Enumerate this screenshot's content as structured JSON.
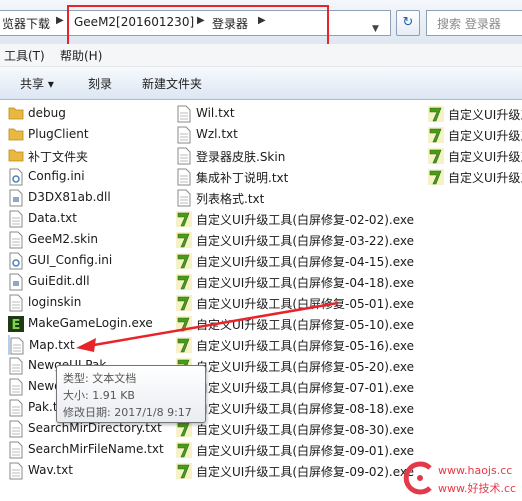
{
  "address": {
    "crumbs": [
      "览器下载",
      "GeeM2[201601230]",
      "登录器"
    ],
    "search_placeholder": "搜索 登录器"
  },
  "menu": [
    "工具(T)",
    "帮助(H)"
  ],
  "commands": [
    "共享 ▾",
    "刻录",
    "新建文件夹"
  ],
  "col1": [
    {
      "name": "debug",
      "icon": "folder"
    },
    {
      "name": "PlugClient",
      "icon": "folder"
    },
    {
      "name": "补丁文件夹",
      "icon": "folder"
    },
    {
      "name": "Config.ini",
      "icon": "ini"
    },
    {
      "name": "D3DX81ab.dll",
      "icon": "dll"
    },
    {
      "name": "Data.txt",
      "icon": "doc"
    },
    {
      "name": "GeeM2.skin",
      "icon": "doc"
    },
    {
      "name": "GUI_Config.ini",
      "icon": "ini"
    },
    {
      "name": "GuiEdit.dll",
      "icon": "dll"
    },
    {
      "name": "loginskin",
      "icon": "doc"
    },
    {
      "name": "MakeGameLogin.exe",
      "icon": "exe-e"
    },
    {
      "name": "Map.txt",
      "icon": "doc"
    },
    {
      "name": "NewgeUI.Pak",
      "icon": "doc"
    },
    {
      "name": "Newo",
      "icon": "doc"
    },
    {
      "name": "Pak.txt",
      "icon": "doc"
    },
    {
      "name": "SearchMirDirectory.txt",
      "icon": "doc"
    },
    {
      "name": "SearchMirFileName.txt",
      "icon": "doc"
    },
    {
      "name": "Wav.txt",
      "icon": "doc"
    }
  ],
  "col2": [
    {
      "name": "Wil.txt",
      "icon": "doc"
    },
    {
      "name": "Wzl.txt",
      "icon": "doc"
    },
    {
      "name": "登录器皮肤.Skin",
      "icon": "doc"
    },
    {
      "name": "集成补丁说明.txt",
      "icon": "doc"
    },
    {
      "name": "列表格式.txt",
      "icon": "doc"
    },
    {
      "name": "自定义UI升级工具(白屏修复-02-02).exe",
      "icon": "exe-7"
    },
    {
      "name": "自定义UI升级工具(白屏修复-03-22).exe",
      "icon": "exe-7"
    },
    {
      "name": "自定义UI升级工具(白屏修复-04-15).exe",
      "icon": "exe-7"
    },
    {
      "name": "自定义UI升级工具(白屏修复-04-18).exe",
      "icon": "exe-7"
    },
    {
      "name": "自定义UI升级工具(白屏修复-05-01).exe",
      "icon": "exe-7"
    },
    {
      "name": "自定义UI升级工具(白屏修复-05-10).exe",
      "icon": "exe-7"
    },
    {
      "name": "自定义UI升级工具(白屏修复-05-16).exe",
      "icon": "exe-7"
    },
    {
      "name": "自定义UI升级工具(白屏修复-05-20).exe",
      "icon": "exe-7"
    },
    {
      "name": "自定义UI升级工具(白屏修复-07-01).exe",
      "icon": "exe-7"
    },
    {
      "name": "自定义UI升级工具(白屏修复-08-18).exe",
      "icon": "exe-7"
    },
    {
      "name": "自定义UI升级工具(白屏修复-08-30).exe",
      "icon": "exe-7"
    },
    {
      "name": "自定义UI升级工具(白屏修复-09-01).exe",
      "icon": "exe-7"
    },
    {
      "name": "自定义UI升级工具(白屏修复-09-02).exe",
      "icon": "exe-7"
    }
  ],
  "col3": [
    {
      "name": "自定义UI升级工",
      "icon": "exe-7"
    },
    {
      "name": "自定义UI升级工",
      "icon": "exe-7"
    },
    {
      "name": "自定义UI升级工",
      "icon": "exe-7"
    },
    {
      "name": "自定义UI升级工",
      "icon": "exe-7"
    }
  ],
  "tooltip": {
    "type": "类型: 文本文档",
    "size": "大小: 1.91 KB",
    "modified": "修改日期: 2017/1/8 9:17"
  },
  "watermark": {
    "line1": "www.haojs.cc",
    "line2": "www.好技术.cc"
  },
  "colors": {
    "highlight_red": "#e8232a",
    "exe_green": "#4a9b1a",
    "folder_yellow": "#e8b93e"
  }
}
